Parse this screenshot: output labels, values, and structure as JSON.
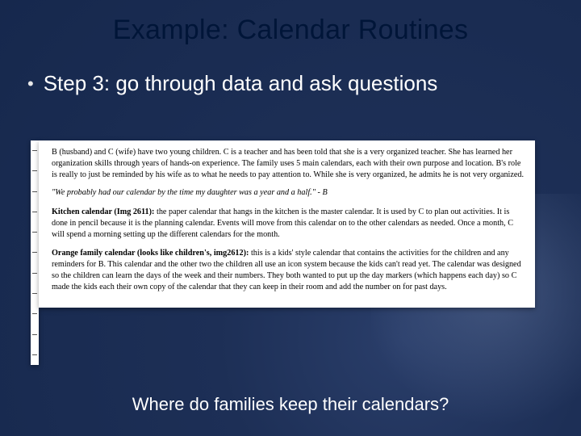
{
  "title": "Example: Calendar Routines",
  "bullet": {
    "marker": "•",
    "text": "Step 3: go through data and ask questions"
  },
  "document": {
    "intro": "B (husband) and C (wife) have two young children. C is a teacher and has been told that she is a very organized teacher. She has learned her organization skills through years of hands-on experience. The family uses 5 main calendars, each with their own purpose and location. B's role is really to just be reminded by his wife as to what he needs to pay attention to. While she is very organized, he admits he is not very organized.",
    "quote": "\"We probably had our calendar by the time my daughter was a year and a half.\" - B",
    "section1": {
      "lead": "Kitchen calendar (Img 2611):",
      "body": " the paper calendar that hangs in the kitchen is the master calendar. It is used by C to plan out activities. It is done in pencil because it is the planning calendar. Events will move from this calendar on to the other calendars as needed. Once a month, C will spend a morning setting up the different calendars for the month."
    },
    "section2": {
      "lead": "Orange family calendar (looks like children's, img2612):",
      "body": " this is a kids' style calendar that contains the activities for the children and any reminders for B. This calendar and the other two the children all use an icon system because the kids can't read yet. The calendar was designed so the children can learn the days of the week and their numbers. They both wanted to put up the day markers (which happens each day) so C made the kids each their own copy of the calendar that they can keep in their room and add the number on for past days."
    }
  },
  "caption": "Where do families keep their calendars?"
}
